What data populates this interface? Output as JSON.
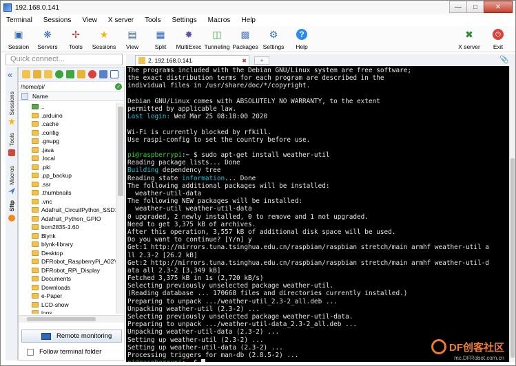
{
  "window": {
    "title": "192.168.0.141"
  },
  "menu": [
    "Terminal",
    "Sessions",
    "View",
    "X server",
    "Tools",
    "Settings",
    "Macros",
    "Help"
  ],
  "toolbar": [
    {
      "label": "Session",
      "icon": "session-icon"
    },
    {
      "label": "Servers",
      "icon": "servers-icon"
    },
    {
      "label": "Tools",
      "icon": "tools-icon"
    },
    {
      "label": "Sessions",
      "icon": "sessions-star-icon"
    },
    {
      "label": "View",
      "icon": "view-icon"
    },
    {
      "label": "Split",
      "icon": "split-icon"
    },
    {
      "label": "MultiExec",
      "icon": "multiexec-icon"
    },
    {
      "label": "Tunneling",
      "icon": "tunneling-icon"
    },
    {
      "label": "Packages",
      "icon": "packages-icon"
    },
    {
      "label": "Settings",
      "icon": "settings-icon"
    },
    {
      "label": "Help",
      "icon": "help-icon"
    },
    {
      "label": "X server",
      "icon": "xserver-icon"
    },
    {
      "label": "Exit",
      "icon": "exit-icon"
    }
  ],
  "quick_connect": {
    "placeholder": "Quick connect..."
  },
  "side_tabs": [
    "Sessions",
    "Tools",
    "Macros",
    "Sftp"
  ],
  "sftp": {
    "path": "/home/pi/",
    "column_name": "Name",
    "files": [
      "..",
      ".arduino",
      ".cache",
      ".config",
      ".gnupg",
      ".java",
      ".local",
      ".pki",
      ".pp_backup",
      ".ssr",
      ".thumbnails",
      ".vnc",
      "Adafruit_CircuitPython_SSD1...",
      "Adafruit_Python_GPIO",
      "bcm2835-1.60",
      "Blynk",
      "blynk-library",
      "Desktop",
      "DFRobot_RaspberryPi_A02YY...",
      "DFRobot_RPi_Display",
      "Documents",
      "Downloads",
      "e-Paper",
      "LCD-show",
      "logs"
    ],
    "remote_monitoring": "Remote monitoring",
    "follow_folder": "Follow terminal folder"
  },
  "tab": {
    "label": "2. 192.168.0.141",
    "new_tab": "+"
  },
  "terminal": {
    "lines": [
      [
        {
          "t": "The programs included with the Debian GNU/Linux system are free software;"
        }
      ],
      [
        {
          "t": "the exact distribution terms for each program are described in the"
        }
      ],
      [
        {
          "t": "individual files in /usr/share/doc/*/copyright."
        }
      ],
      [
        {
          "t": ""
        }
      ],
      [
        {
          "t": "Debian GNU/Linux comes with ABSOLUTELY NO WARRANTY, to the extent"
        }
      ],
      [
        {
          "t": "permitted by applicable law."
        }
      ],
      [
        {
          "t": "Last login:",
          "c": "cyan"
        },
        {
          "t": " Wed Mar 25 08:18:00 2020"
        }
      ],
      [
        {
          "t": ""
        }
      ],
      [
        {
          "t": "Wi-Fi is currently blocked by rfkill."
        }
      ],
      [
        {
          "t": "Use raspi-config to set the country before use."
        }
      ],
      [
        {
          "t": ""
        }
      ],
      [
        {
          "t": "pi@raspberrypi",
          "c": "green"
        },
        {
          "t": ":~ $ sudo apt-get install weather-util"
        }
      ],
      [
        {
          "t": "Reading package lists... Done"
        }
      ],
      [
        {
          "t": "Building",
          "c": "cyan"
        },
        {
          "t": " dependency tree"
        }
      ],
      [
        {
          "t": "Reading state "
        },
        {
          "t": "information",
          "c": "cyan"
        },
        {
          "t": "... Done"
        }
      ],
      [
        {
          "t": "The following additional packages will be installed:"
        }
      ],
      [
        {
          "t": "  weather-util-data"
        }
      ],
      [
        {
          "t": "The following NEW packages will be installed:"
        }
      ],
      [
        {
          "t": "  weather-util weather-util-data"
        }
      ],
      [
        {
          "t": "0 upgraded, 2 newly installed, 0 to remove and 1 not upgraded."
        }
      ],
      [
        {
          "t": "Need to get 3,375 kB of archives."
        }
      ],
      [
        {
          "t": "After this operation, 3,557 kB of additional disk space will be used."
        }
      ],
      [
        {
          "t": "Do you want to continue? [Y/n] y"
        }
      ],
      [
        {
          "t": "Get:1 http://mirrors.tuna.tsinghua.edu.cn/raspbian/raspbian stretch/main armhf weather-util a"
        }
      ],
      [
        {
          "t": "ll 2.3-2 [26.2 kB]"
        }
      ],
      [
        {
          "t": "Get:2 http://mirrors.tuna.tsinghua.edu.cn/raspbian/raspbian stretch/main armhf weather-util-d"
        }
      ],
      [
        {
          "t": "ata all 2.3-2 [3,349 kB]"
        }
      ],
      [
        {
          "t": "Fetched 3,375 kB in 1s (2,720 kB/s)"
        }
      ],
      [
        {
          "t": "Selecting previously unselected package weather-util."
        }
      ],
      [
        {
          "t": "(Reading database ... 170668 files and directories currently installed.)"
        }
      ],
      [
        {
          "t": "Preparing to unpack .../weather-util_2.3-2_all.deb ..."
        }
      ],
      [
        {
          "t": "Unpacking weather-util (2.3-2) ..."
        }
      ],
      [
        {
          "t": "Selecting previously unselected package weather-util-data."
        }
      ],
      [
        {
          "t": "Preparing to unpack .../weather-util-data_2.3-2_all.deb ..."
        }
      ],
      [
        {
          "t": "Unpacking weather-util-data (2.3-2) ..."
        }
      ],
      [
        {
          "t": "Setting up weather-util (2.3-2) ..."
        }
      ],
      [
        {
          "t": "Setting up weather-util-data (2.3-2) ..."
        }
      ],
      [
        {
          "t": "Processing triggers for man-db (2.8.5-2) ..."
        }
      ],
      [
        {
          "t": "pi@raspberrypi",
          "c": "green"
        },
        {
          "t": ":~ $ "
        },
        {
          "cursor": true
        }
      ]
    ]
  },
  "watermark": {
    "logo": "DF创客社区",
    "url": "mc.DFRobot.com.cn"
  },
  "colors": {
    "terminal_bg": "#000000",
    "prompt_green": "#2ad32a",
    "highlight_cyan": "#1fc3d8",
    "brand_orange": "#ef7b2d"
  }
}
